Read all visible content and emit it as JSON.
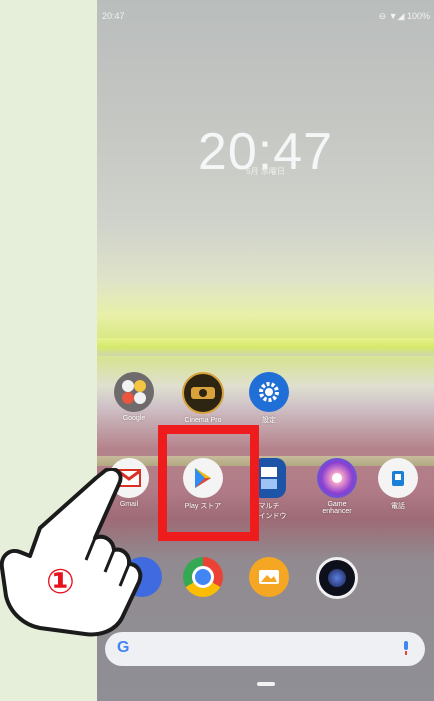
{
  "status_bar": {
    "time": "20:47",
    "right": "⊖ ▼◢ 100%"
  },
  "lock_clock": {
    "time": "20:47",
    "date": "5月 水曜日"
  },
  "dock_row1": [
    {
      "label": "Google",
      "icon": "google-folder-icon"
    },
    {
      "label": "Cinema Pro",
      "icon": "cinema-pro-icon"
    },
    {
      "label": "設定",
      "icon": "settings-gear-icon"
    }
  ],
  "dock_row2": [
    {
      "label": "Gmail",
      "icon": "gmail-icon"
    },
    {
      "label": "Play ストア",
      "icon": "play-store-icon"
    },
    {
      "label": "マルチ\nウインドウ",
      "icon": "multi-window-icon"
    },
    {
      "label": "Game\nenhancer",
      "icon": "game-enhancer-icon"
    },
    {
      "label": "電話",
      "icon": "phone-icon"
    }
  ],
  "dock_row3": [
    {
      "label": "",
      "icon": "messages-icon"
    },
    {
      "label": "",
      "icon": "chrome-icon"
    },
    {
      "label": "",
      "icon": "gallery-icon"
    },
    {
      "label": "",
      "icon": "camera-icon"
    }
  ],
  "search": {
    "logo": "G"
  },
  "annotation": {
    "step": "①",
    "highlight_color": "#ee1c1c"
  },
  "colors": {
    "page_bg": "#e6efd9",
    "accent": "#ee1c1c"
  }
}
